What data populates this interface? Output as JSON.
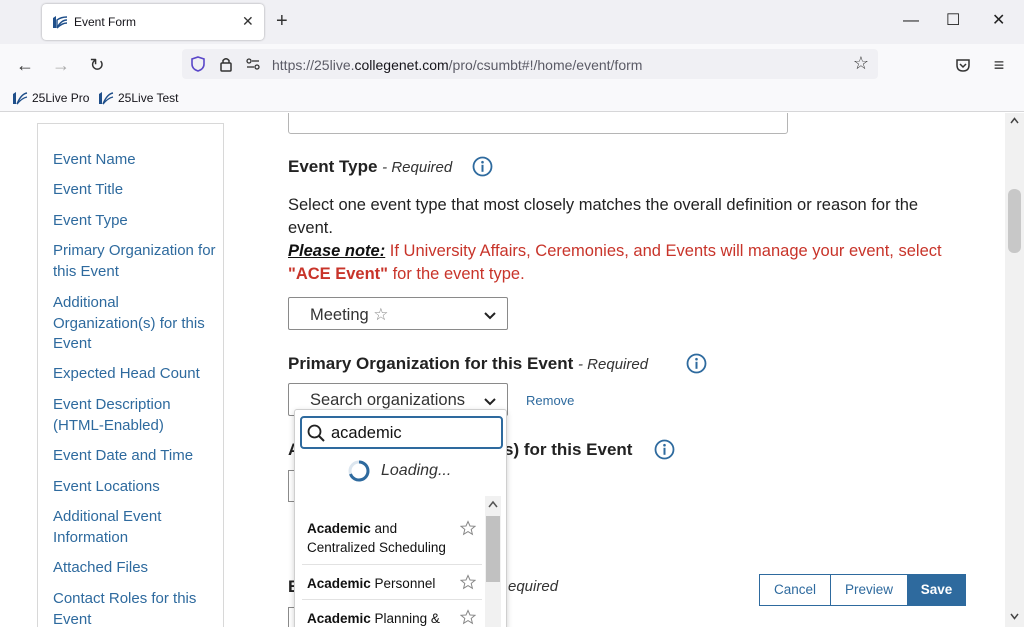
{
  "browser": {
    "tab_title": "Event Form",
    "url_prefix": "https://25live.",
    "url_host": "collegenet.com",
    "url_path": "/pro/csumbt#!/home/event/form",
    "bookmarks": [
      "25Live Pro",
      "25Live Test"
    ]
  },
  "sidenav": {
    "items": [
      "Event Name",
      "Event Title",
      "Event Type",
      "Primary Organization for this Event",
      "Additional Organization(s) for this Event",
      "Expected Head Count",
      "Event Description (HTML-Enabled)",
      "Event Date and Time",
      "Event Locations",
      "Additional Event Information",
      "Attached Files",
      "Contact Roles for this Event"
    ]
  },
  "event_type": {
    "heading": "Event Type",
    "required": "- Required",
    "description": "Select one event type that most closely matches the overall definition or reason for the event.",
    "note_label": "Please note:",
    "note_text_1": " If University Affairs, Ceremonies, and Events will manage your event, select ",
    "note_bold": "\"ACE Event\"",
    "note_text_2": " for the event type.",
    "selected": "Meeting"
  },
  "primary_org": {
    "heading": "Primary Organization for this Event",
    "required": "- Required",
    "select_placeholder": "Search organizations",
    "remove_label": "Remove"
  },
  "additional_org": {
    "heading_prefix": "A",
    "heading_suffix": "s) for this Event"
  },
  "hidden_section": {
    "heading_prefix": "E",
    "required_suffix": "equired"
  },
  "dropdown": {
    "search_value": "academic",
    "loading_text": "Loading...",
    "options": [
      {
        "bold": "Academic",
        "rest": " and Centralized Scheduling"
      },
      {
        "bold": "Academic",
        "rest": " Personnel"
      },
      {
        "bold": "Academic",
        "rest": " Planning & Budget"
      }
    ]
  },
  "actions": {
    "cancel": "Cancel",
    "preview": "Preview",
    "save": "Save"
  },
  "colors": {
    "link": "#2e6a9e",
    "required_note": "#c8342a",
    "primary_button": "#2e6a9e"
  }
}
